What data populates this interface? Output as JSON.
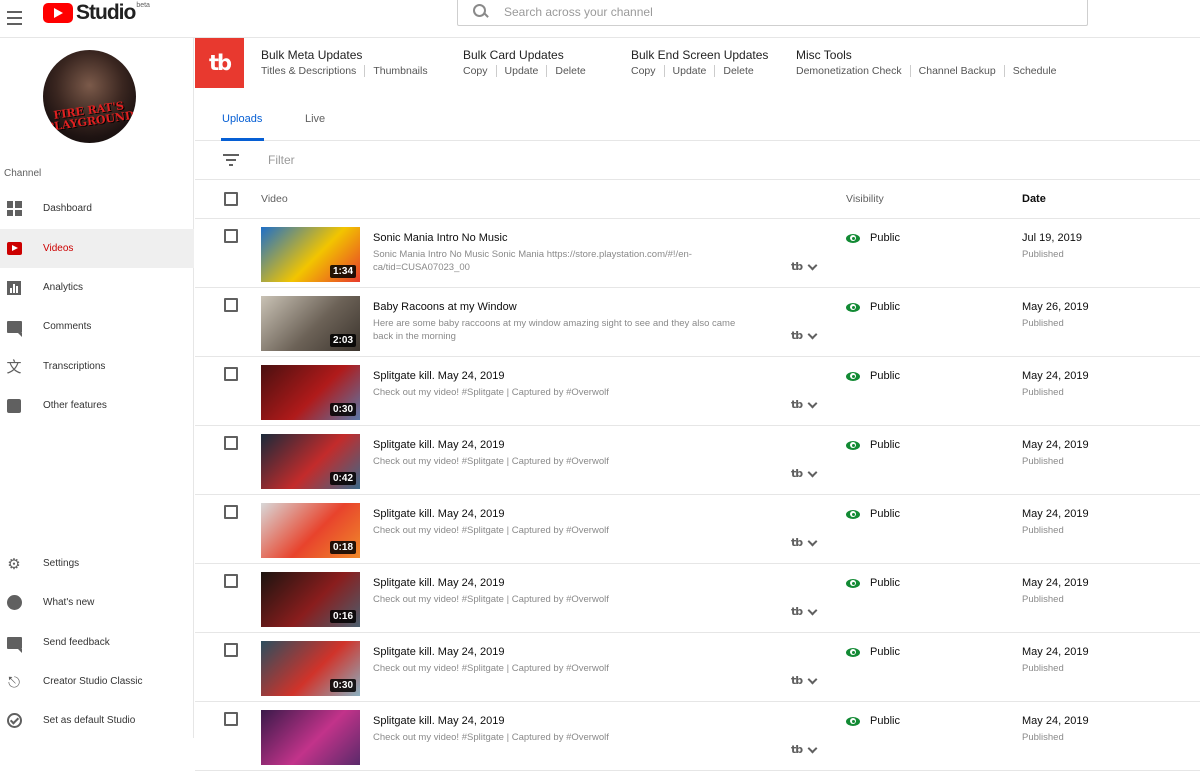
{
  "app": {
    "title": "Studio",
    "beta": "beta"
  },
  "search": {
    "placeholder": "Search across your channel"
  },
  "sidebar": {
    "avatar_text": "FIRE RAT'S PLAYGROUND",
    "heading": "Channel",
    "items": [
      {
        "label": "Dashboard",
        "icon": "dashboard-icon"
      },
      {
        "label": "Videos",
        "icon": "videos-icon",
        "active": true
      },
      {
        "label": "Analytics",
        "icon": "analytics-icon"
      },
      {
        "label": "Comments",
        "icon": "comments-icon"
      },
      {
        "label": "Transcriptions",
        "icon": "translate-icon"
      },
      {
        "label": "Other features",
        "icon": "other-features-icon"
      }
    ],
    "bottom_items": [
      {
        "label": "Settings",
        "icon": "gear-icon"
      },
      {
        "label": "What's new",
        "icon": "whats-new-icon"
      },
      {
        "label": "Send feedback",
        "icon": "feedback-icon"
      },
      {
        "label": "Creator Studio Classic",
        "icon": "exit-icon"
      },
      {
        "label": "Set as default Studio",
        "icon": "check-circle-icon"
      }
    ]
  },
  "tubebuddy": {
    "logo": "tb",
    "groups": [
      {
        "title": "Bulk Meta Updates",
        "links": [
          "Titles & Descriptions",
          "Thumbnails"
        ]
      },
      {
        "title": "Bulk Card Updates",
        "links": [
          "Copy",
          "Update",
          "Delete"
        ]
      },
      {
        "title": "Bulk End Screen Updates",
        "links": [
          "Copy",
          "Update",
          "Delete"
        ]
      },
      {
        "title": "Misc Tools",
        "links": [
          "Demonetization Check",
          "Channel Backup",
          "Schedule"
        ]
      }
    ]
  },
  "tabs": [
    {
      "label": "Uploads",
      "active": true
    },
    {
      "label": "Live"
    }
  ],
  "filter": {
    "placeholder": "Filter"
  },
  "table": {
    "headers": {
      "video": "Video",
      "visibility": "Visibility",
      "date": "Date"
    },
    "rows": [
      {
        "title": "Sonic Mania Intro No Music",
        "desc": "Sonic Mania Intro No Music Sonic Mania https://store.playstation.com/#!/en-ca/tid=CUSA07023_00",
        "duration": "1:34",
        "visibility": "Public",
        "date": "Jul 19, 2019",
        "status": "Published",
        "thumb_colors": [
          "#1e6fc8",
          "#f2c500",
          "#e83a2b"
        ]
      },
      {
        "title": "Baby Racoons at my Window",
        "desc": "Here are some baby raccoons at my window amazing sight to see and they also came back in the morning",
        "duration": "2:03",
        "visibility": "Public",
        "date": "May 26, 2019",
        "status": "Published",
        "thumb_colors": [
          "#c9c2b5",
          "#6c6257",
          "#3b342d"
        ]
      },
      {
        "title": "Splitgate kill. May 24, 2019",
        "desc": "Check out my video! #Splitgate | Captured by #Overwolf",
        "duration": "0:30",
        "visibility": "Public",
        "date": "May 24, 2019",
        "status": "Published",
        "thumb_colors": [
          "#4a1010",
          "#b01a1a",
          "#5a78a8"
        ]
      },
      {
        "title": "Splitgate kill. May 24, 2019",
        "desc": "Check out my video! #Splitgate | Captured by #Overwolf",
        "duration": "0:42",
        "visibility": "Public",
        "date": "May 24, 2019",
        "status": "Published",
        "thumb_colors": [
          "#1a2a3a",
          "#c32b2b",
          "#3a6a8a"
        ]
      },
      {
        "title": "Splitgate kill. May 24, 2019",
        "desc": "Check out my video! #Splitgate | Captured by #Overwolf",
        "duration": "0:18",
        "visibility": "Public",
        "date": "May 24, 2019",
        "status": "Published",
        "thumb_colors": [
          "#d8d8d8",
          "#e8432c",
          "#f08a2a"
        ]
      },
      {
        "title": "Splitgate kill. May 24, 2019",
        "desc": "Check out my video! #Splitgate | Captured by #Overwolf",
        "duration": "0:16",
        "visibility": "Public",
        "date": "May 24, 2019",
        "status": "Published",
        "thumb_colors": [
          "#1c1410",
          "#8a1d1d",
          "#4b5f6e"
        ]
      },
      {
        "title": "Splitgate kill. May 24, 2019",
        "desc": "Check out my video! #Splitgate | Captured by #Overwolf",
        "duration": "0:30",
        "visibility": "Public",
        "date": "May 24, 2019",
        "status": "Published",
        "thumb_colors": [
          "#2c4e5e",
          "#d0332a",
          "#8ab0c0"
        ]
      },
      {
        "title": "Splitgate kill. May 24, 2019",
        "desc": "Check out my video! #Splitgate | Captured by #Overwolf",
        "duration": "",
        "visibility": "Public",
        "date": "May 24, 2019",
        "status": "Published",
        "thumb_colors": [
          "#3a1a4a",
          "#c2338a",
          "#5a2a6a"
        ]
      }
    ]
  },
  "colors": {
    "accent_blue": "#065fd4",
    "youtube_red": "#ff0000",
    "tubebuddy_red": "#e8392f",
    "public_green": "#128a34"
  }
}
